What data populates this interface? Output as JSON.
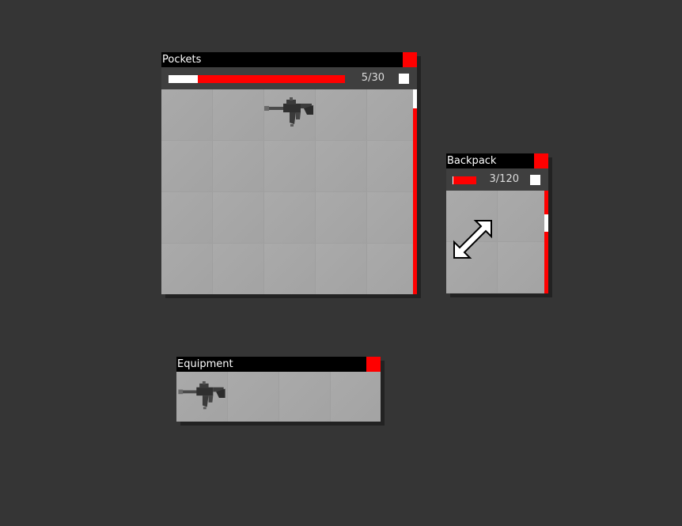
{
  "colors": {
    "background": "#353535",
    "accent": "#ff0000",
    "titlebar": "#000000"
  },
  "pockets": {
    "title": "Pockets",
    "count": "5/30",
    "capacity_used_fraction": 0.167,
    "items": [
      {
        "name": "assault-rifle-icon"
      }
    ]
  },
  "backpack": {
    "title": "Backpack",
    "count": "3/120",
    "capacity_used_fraction": 0.025,
    "resize_icon": "resize-arrow-icon"
  },
  "equipment": {
    "title": "Equipment",
    "items": [
      {
        "name": "assault-rifle-icon"
      }
    ]
  }
}
